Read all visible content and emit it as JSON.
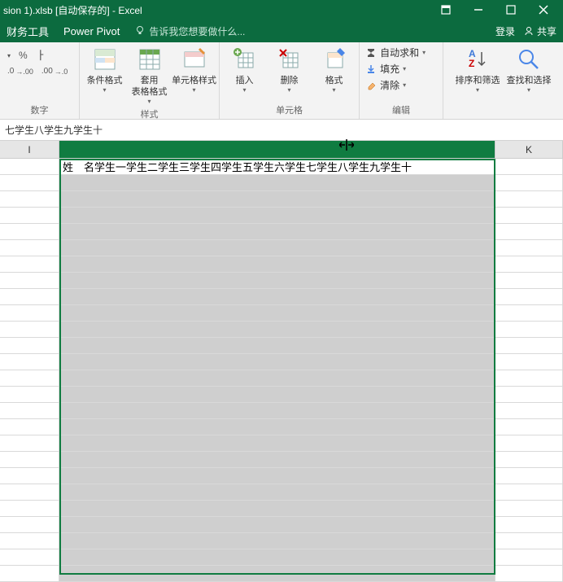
{
  "title": "sion 1).xlsb [自动保存的] - Excel",
  "tabs": {
    "finance": "财务工具",
    "powerpivot": "Power Pivot"
  },
  "tellme": "告诉我您想要做什么...",
  "login": "登录",
  "share": "共享",
  "ribbon": {
    "number": {
      "label": "数字",
      "percent": "%",
      "comma": ",",
      "incdec": ".0",
      "decdec": ".0"
    },
    "styles": {
      "label": "样式",
      "cond": "条件格式",
      "table": "套用\n表格格式",
      "cell": "单元格样式"
    },
    "cells": {
      "label": "单元格",
      "insert": "插入",
      "delete": "删除",
      "format": "格式"
    },
    "editing": {
      "label": "编辑",
      "autosum": "自动求和",
      "fill": "填充",
      "clear": "清除",
      "sort": "排序和筛选",
      "find": "查找和选择"
    }
  },
  "formula_bar": "七学生八学生九学生十",
  "columns": {
    "I": "I",
    "J": "",
    "K": "K"
  },
  "cell_content": "姓　名学生一学生二学生三学生四学生五学生六学生七学生八学生九学生十",
  "col_widths": {
    "I": 73,
    "J": 536,
    "K": 83
  }
}
